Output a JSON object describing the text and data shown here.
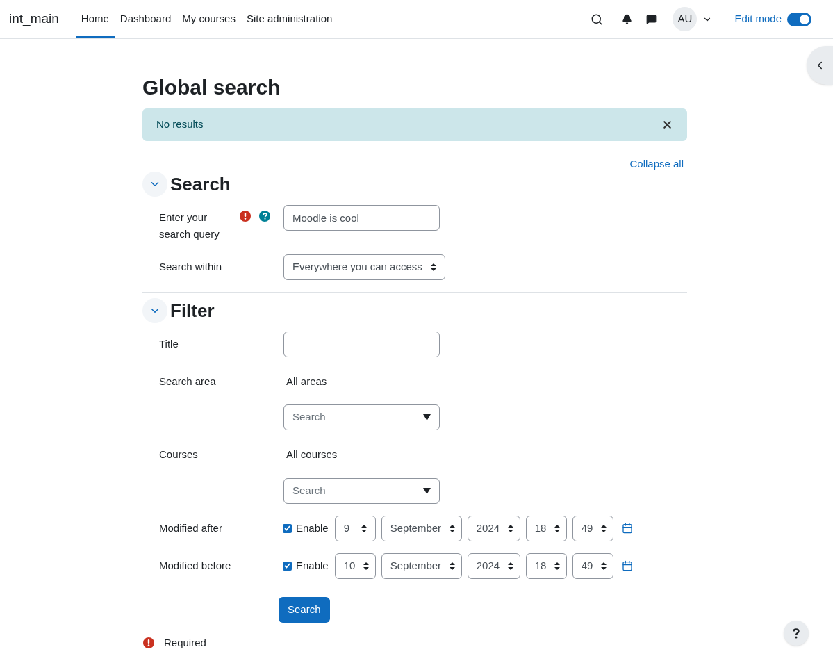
{
  "navbar": {
    "brand": "int_main",
    "links": [
      {
        "label": "Home",
        "selected": true
      },
      {
        "label": "Dashboard",
        "selected": false
      },
      {
        "label": "My courses",
        "selected": false
      },
      {
        "label": "Site administration",
        "selected": false
      }
    ],
    "avatar": "AU",
    "edit_mode": {
      "label": "Edit mode",
      "on": true
    }
  },
  "page": {
    "title": "Global search",
    "alert": "No results",
    "collapse_all": "Collapse all",
    "sections": [
      {
        "title": "Search",
        "expanded": true,
        "fields": [
          {
            "kind": "text",
            "label": "Enter your search query",
            "value": "Moodle is cool",
            "required": true,
            "help": true
          },
          {
            "kind": "select",
            "label": "Search within",
            "value": "Everywhere you can access"
          }
        ]
      },
      {
        "title": "Filter",
        "expanded": true,
        "fields": [
          {
            "kind": "text",
            "label": "Title"
          },
          {
            "kind": "autocomplete",
            "label": "Search area",
            "selection": "All areas",
            "placeholder": "Search"
          },
          {
            "kind": "autocomplete",
            "label": "Courses",
            "selection": "All courses",
            "placeholder": "Search"
          },
          {
            "kind": "datetime",
            "label": "Modified after",
            "enable_label": "Enable",
            "enabled": true,
            "parts": [
              "9",
              "September",
              "2024",
              "18",
              "49"
            ]
          },
          {
            "kind": "datetime",
            "label": "Modified before",
            "enable_label": "Enable",
            "enabled": true,
            "parts": [
              "10",
              "September",
              "2024",
              "18",
              "49"
            ]
          }
        ]
      }
    ],
    "submit": "Search",
    "required_legend": "Required"
  }
}
